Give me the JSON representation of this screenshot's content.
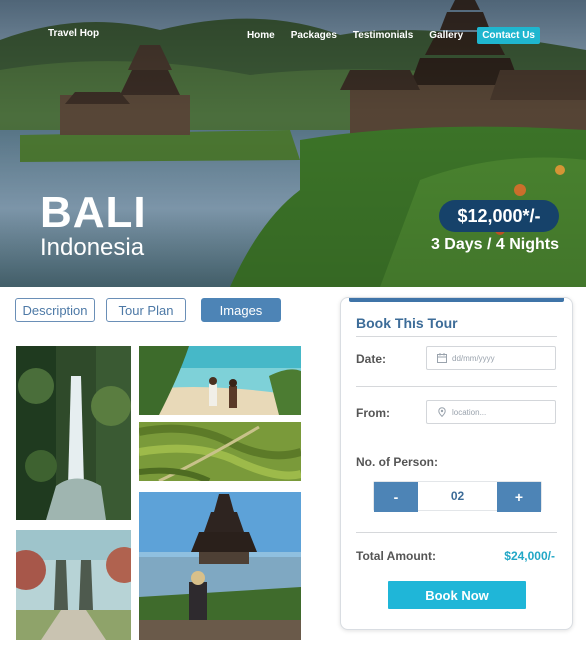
{
  "brand": "Travel Hop",
  "nav": {
    "items": [
      "Home",
      "Packages",
      "Testimonials",
      "Gallery"
    ],
    "cta": "Contact Us"
  },
  "hero": {
    "title": "BALI",
    "subtitle": "Indonesia",
    "price": "$12,000*/-",
    "duration": "3 Days / 4 Nights"
  },
  "tabs": [
    "Description",
    "Tour Plan",
    "Images"
  ],
  "gallery": {
    "images": [
      "waterfall-photo",
      "beach-couple-photo",
      "rice-terraces-photo",
      "temple-gate-photo",
      "lake-temple-photo"
    ]
  },
  "booking": {
    "title": "Book This Tour",
    "date_label": "Date:",
    "date_placeholder": "dd/mm/yyyy",
    "from_label": "From:",
    "from_placeholder": "location...",
    "persons_label": "No. of Person:",
    "minus": "-",
    "count": "02",
    "plus": "+",
    "total_label": "Total Amount:",
    "total_value": "$24,000/-",
    "button": "Book Now"
  },
  "colors": {
    "accent_cyan": "#1fb6d8",
    "primary_blue": "#4d84b6",
    "navy": "#16426a"
  }
}
